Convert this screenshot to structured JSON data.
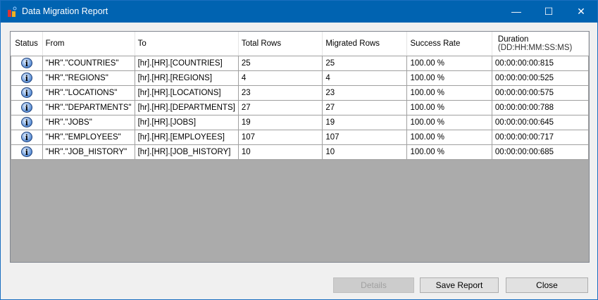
{
  "window": {
    "title": "Data Migration Report",
    "controls": {
      "minimize": "—",
      "maximize": "☐",
      "close": "✕"
    }
  },
  "table": {
    "headers": [
      "Status",
      "From",
      "To",
      "Total Rows",
      "Migrated Rows",
      "Success Rate",
      "Duration",
      "(DD:HH:MM:SS:MS)"
    ],
    "rows": [
      {
        "status": "info",
        "from": "\"HR\".\"COUNTRIES\"",
        "to": "[hr].[HR].[COUNTRIES]",
        "total": "25",
        "migrated": "25",
        "rate": "100.00 %",
        "duration": "00:00:00:00:815"
      },
      {
        "status": "info",
        "from": "\"HR\".\"REGIONS\"",
        "to": "[hr].[HR].[REGIONS]",
        "total": "4",
        "migrated": "4",
        "rate": "100.00 %",
        "duration": "00:00:00:00:525"
      },
      {
        "status": "info",
        "from": "\"HR\".\"LOCATIONS\"",
        "to": "[hr].[HR].[LOCATIONS]",
        "total": "23",
        "migrated": "23",
        "rate": "100.00 %",
        "duration": "00:00:00:00:575"
      },
      {
        "status": "info",
        "from": "\"HR\".\"DEPARTMENTS\"",
        "to": "[hr].[HR].[DEPARTMENTS]",
        "total": "27",
        "migrated": "27",
        "rate": "100.00 %",
        "duration": "00:00:00:00:788"
      },
      {
        "status": "info",
        "from": "\"HR\".\"JOBS\"",
        "to": "[hr].[HR].[JOBS]",
        "total": "19",
        "migrated": "19",
        "rate": "100.00 %",
        "duration": "00:00:00:00:645"
      },
      {
        "status": "info",
        "from": "\"HR\".\"EMPLOYEES\"",
        "to": "[hr].[HR].[EMPLOYEES]",
        "total": "107",
        "migrated": "107",
        "rate": "100.00 %",
        "duration": "00:00:00:00:717"
      },
      {
        "status": "info",
        "from": "\"HR\".\"JOB_HISTORY\"",
        "to": "[hr].[HR].[JOB_HISTORY]",
        "total": "10",
        "migrated": "10",
        "rate": "100.00 %",
        "duration": "00:00:00:00:685"
      }
    ]
  },
  "buttons": {
    "details": "Details",
    "save": "Save Report",
    "close": "Close"
  },
  "colors": {
    "titlebar": "#0063b1",
    "grid_empty": "#ababab"
  }
}
